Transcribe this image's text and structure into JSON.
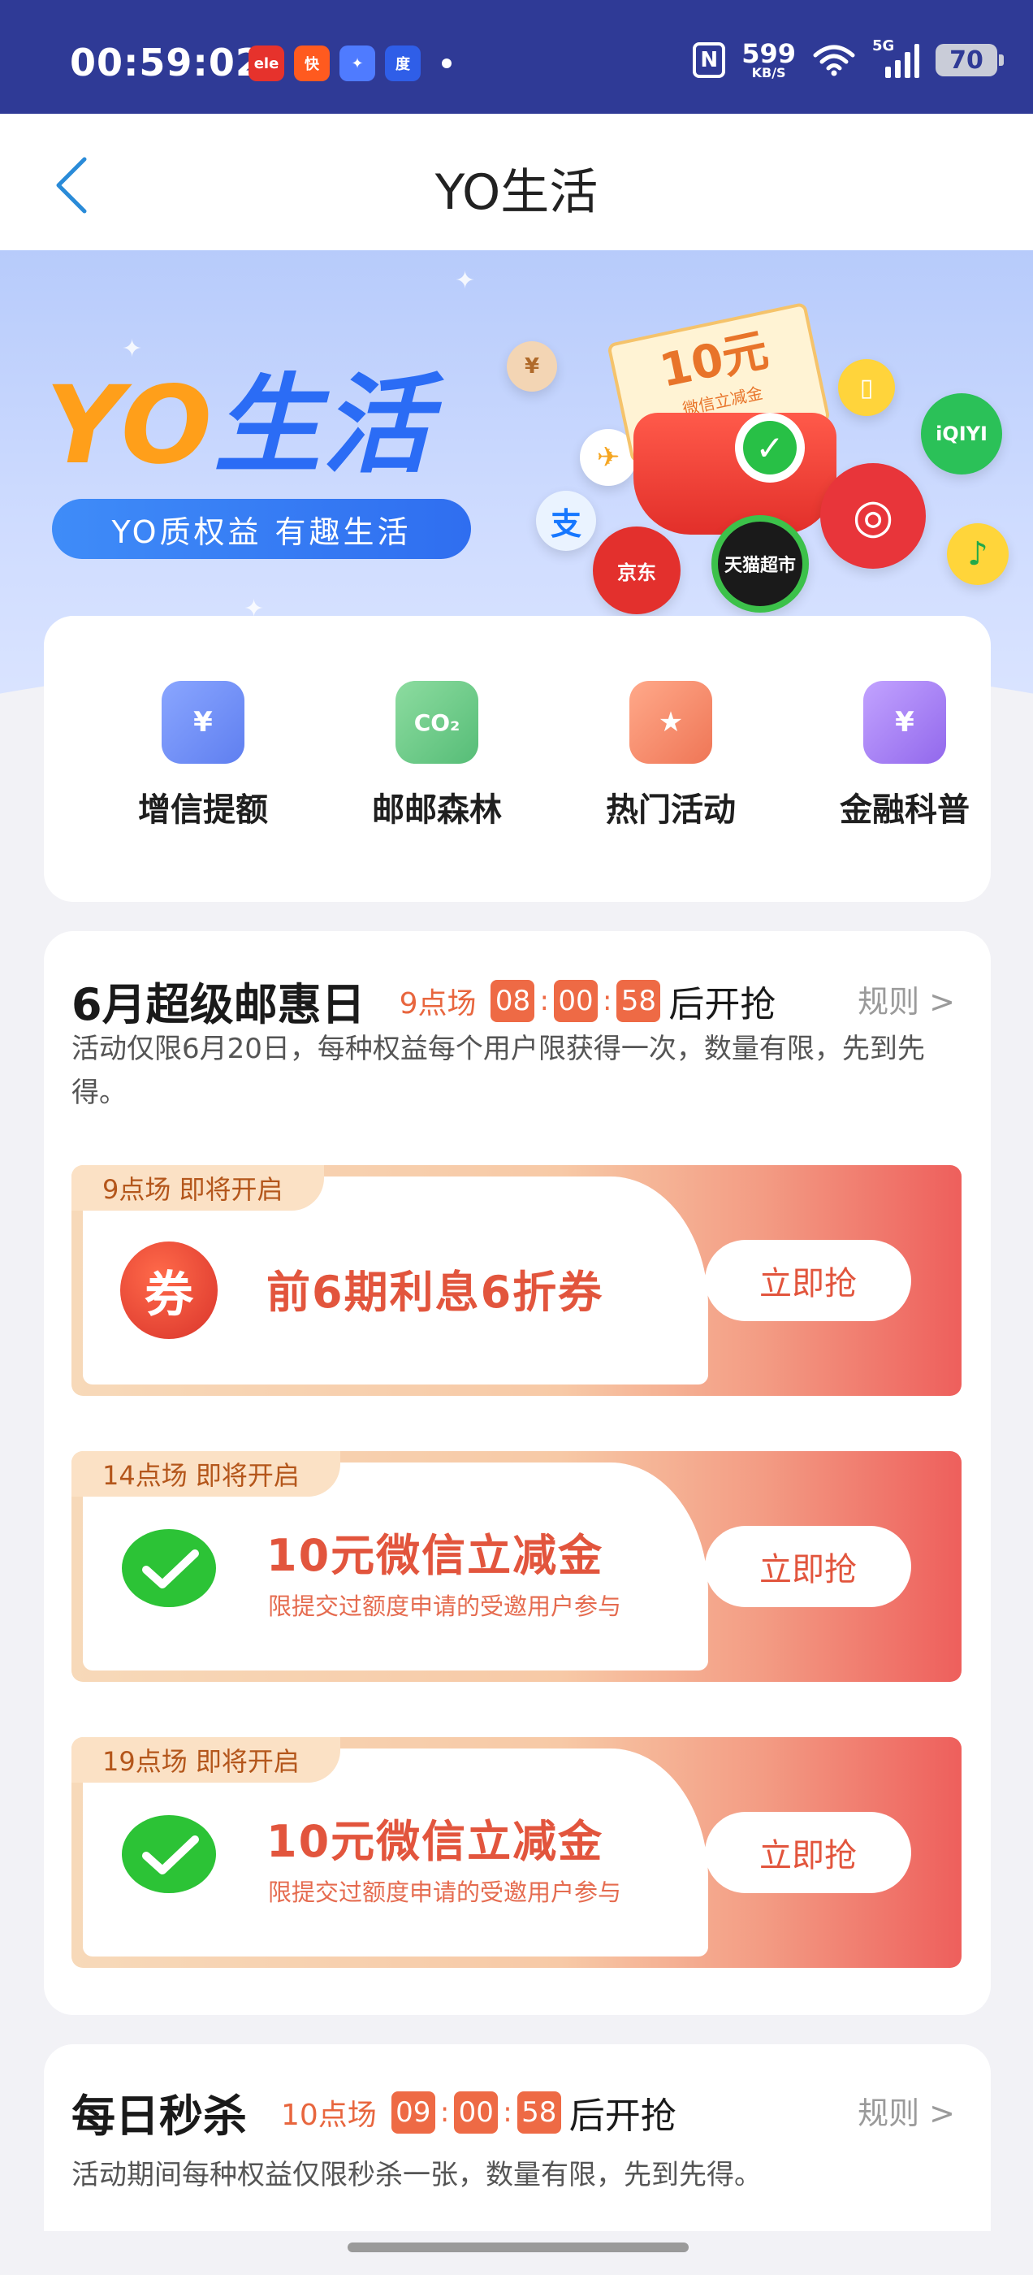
{
  "status_bar": {
    "time": "00:59:02",
    "apps": [
      {
        "icon": "eleme-icon",
        "text": "ele",
        "color": "#e6322c"
      },
      {
        "icon": "kuaishou-icon",
        "text": "快",
        "color": "#ff5a1f"
      },
      {
        "icon": "photos-icon",
        "text": "✦",
        "color": "#4f7bff"
      },
      {
        "icon": "baidu-icon",
        "text": "度",
        "color": "#2f5ee8"
      }
    ],
    "nfc": "N",
    "net_speed": "599",
    "net_unit": "KB/S",
    "network": "5G",
    "battery": "70"
  },
  "nav": {
    "back_icon": "chevron-left-icon",
    "title": "YO生活"
  },
  "banner": {
    "logo_yo": "YO",
    "logo_life": "生活",
    "slogan": "YO质权益 有趣生活",
    "ticket_amount": "10元",
    "ticket_sub": "微信立减金",
    "brand_jd": "京东",
    "brand_tmall": "天猫超市",
    "brand_iqiyi": "iQIYI"
  },
  "quick_menu": [
    {
      "label": "增信提额",
      "icon": "wallet-icon",
      "color": "#6e8ff5"
    },
    {
      "label": "邮邮森林",
      "icon": "co2-leaf-icon",
      "color": "#68c986"
    },
    {
      "label": "热门活动",
      "icon": "bookmark-star-icon",
      "color": "#f38a6a"
    },
    {
      "label": "金融科普",
      "icon": "finance-search-icon",
      "color": "#a07cf0"
    }
  ],
  "super_day": {
    "title": "6月超级邮惠日",
    "round": "9点场",
    "countdown": [
      "08",
      "00",
      "58"
    ],
    "after": "后开抢",
    "rules": "规则 >",
    "desc": "活动仅限6月20日，每种权益每个用户限获得一次，数量有限，先到先得。",
    "offers": [
      {
        "tag": "9点场 即将开启",
        "title": "前6期利息6折券",
        "subtitle": "",
        "icon": "coupon-icon",
        "icon_text": "券",
        "button": "立即抢"
      },
      {
        "tag": "14点场 即将开启",
        "title": "10元微信立减金",
        "subtitle": "限提交过额度申请的受邀用户参与",
        "icon": "wechat-icon",
        "icon_text": "",
        "button": "立即抢"
      },
      {
        "tag": "19点场 即将开启",
        "title": "10元微信立减金",
        "subtitle": "限提交过额度申请的受邀用户参与",
        "icon": "wechat-icon",
        "icon_text": "",
        "button": "立即抢"
      }
    ]
  },
  "flash_sale": {
    "title": "每日秒杀",
    "round": "10点场",
    "countdown": [
      "09",
      "00",
      "58"
    ],
    "after": "后开抢",
    "rules": "规则 >",
    "desc": "活动期间每种权益仅限秒杀一张，数量有限，先到先得。"
  },
  "colors": {
    "status_bar": "#2f3a96",
    "accent": "#ee6a45",
    "brand_blue": "#2b6cf5",
    "brand_orange": "#ff9f1a"
  }
}
